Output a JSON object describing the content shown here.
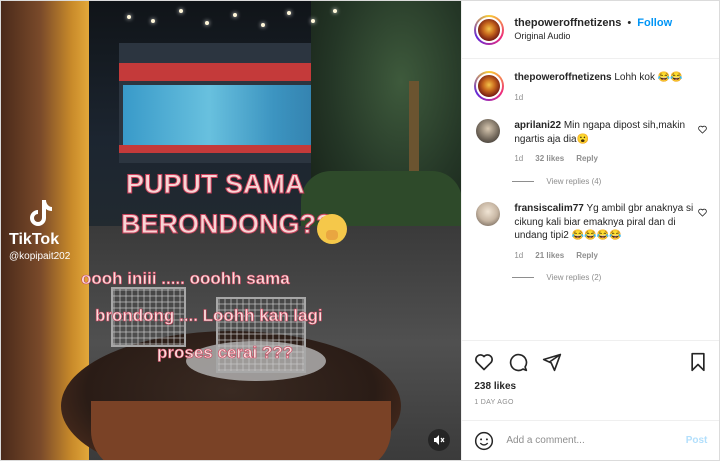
{
  "post": {
    "username": "thepoweroffnetizens",
    "separator": "•",
    "follow_label": "Follow",
    "audio": "Original Audio"
  },
  "caption": {
    "username": "thepoweroffnetizens",
    "text": "Lohh kok",
    "emojis": [
      "😂",
      "😂"
    ],
    "age": "1d"
  },
  "comments": [
    {
      "username": "aprilani22",
      "text": "Min ngapa dipost sih,makin ngartis aja dia😮",
      "age": "1d",
      "likes": "32 likes",
      "reply_label": "Reply",
      "view_replies": "View replies (4)"
    },
    {
      "username": "fransiscalim77",
      "text": "Yg ambil gbr anaknya si cikung kali biar emaknya piral dan di undang tipi2 😂😂😂😂",
      "age": "1d",
      "likes": "21 likes",
      "reply_label": "Reply",
      "view_replies": "View replies (2)"
    }
  ],
  "stats": {
    "likes": "238 likes",
    "date": "1 DAY AGO"
  },
  "composer": {
    "placeholder": "Add a comment...",
    "post_label": "Post"
  },
  "video": {
    "caption_lines": [
      "PUPUT SAMA",
      "BERONDONG??",
      "oooh iniii ..... ooohh sama",
      "brondong .... Loohh kan lagi",
      "proses cerai ???"
    ],
    "watermark_brand": "TikTok",
    "watermark_user": "@kopipait202"
  },
  "icons": {
    "like": "heart-icon",
    "comment": "comment-icon",
    "share": "send-icon",
    "save": "bookmark-icon",
    "emoji": "smiley-icon",
    "mute": "speaker-muted-icon"
  },
  "colors": {
    "accent": "#0095f6",
    "post_disabled": "#b2dffc",
    "caption_stroke": "#c9405a"
  }
}
